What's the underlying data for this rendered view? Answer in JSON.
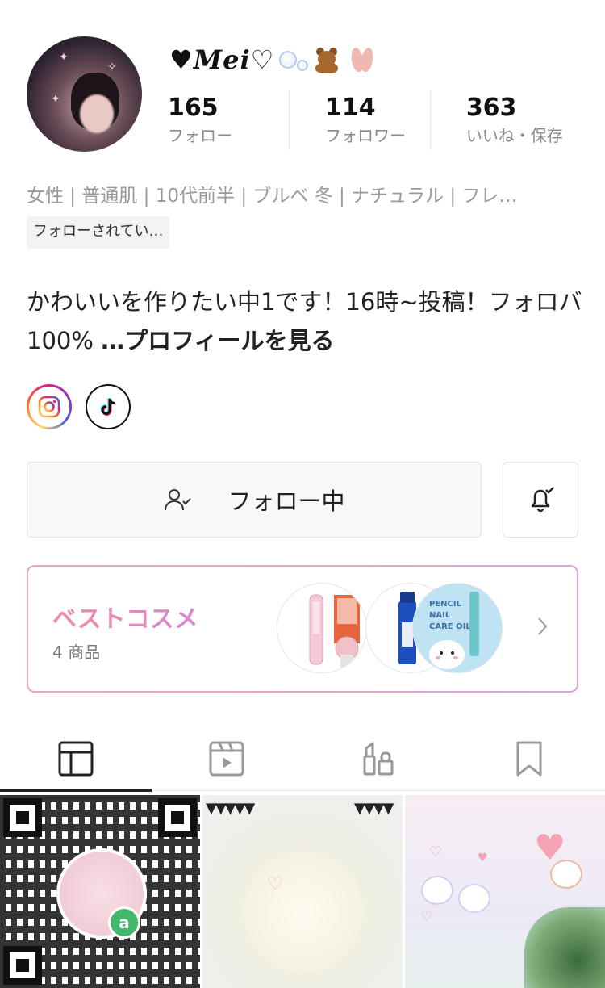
{
  "profile": {
    "username": "♥Mei♡",
    "stats": [
      {
        "value": "165",
        "label": "フォロー"
      },
      {
        "value": "114",
        "label": "フォロワー"
      },
      {
        "value": "363",
        "label": "いいね・保存"
      }
    ],
    "attributes": "女性 | 普通肌 | 10代前半 | ブルベ 冬 | ナチュラル | フレ…",
    "follows_you_badge": "フォローされてい…",
    "bio_text": "かわいいを作りたい中1です！16時~投稿！フォロバ100%",
    "bio_more": "…プロフィールを見る"
  },
  "social": {
    "instagram_icon": "instagram-icon",
    "tiktok_icon": "tiktok-icon"
  },
  "actions": {
    "follow_label": "フォロー中",
    "follow_icon": "user-check-icon",
    "bell_icon": "bell-check-icon"
  },
  "best_cosme": {
    "title": "ベストコスメ",
    "count": "4 商品",
    "thumb_text": "PENCIL NAIL CARE OIL"
  },
  "tabs": [
    {
      "name": "posts",
      "icon": "grid-icon",
      "active": true
    },
    {
      "name": "videos",
      "icon": "video-icon",
      "active": false
    },
    {
      "name": "cosmetics",
      "icon": "lipstick-icon",
      "active": false
    },
    {
      "name": "saved",
      "icon": "bookmark-icon",
      "active": false
    }
  ],
  "colors": {
    "accent_pink": "#f08aa3",
    "accent_purple": "#d68ad0",
    "muted_text": "#9a9a9a"
  }
}
